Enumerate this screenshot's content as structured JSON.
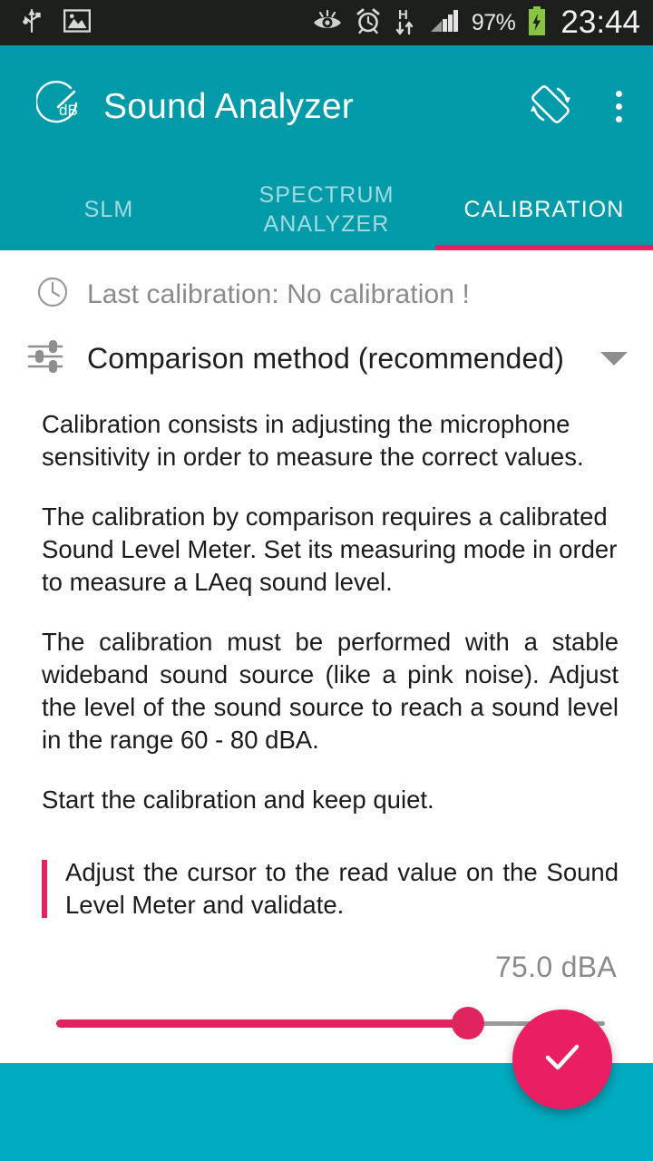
{
  "statusbar": {
    "icons_left": [
      "usb-icon",
      "image-icon"
    ],
    "icons_right": [
      "eye-icon",
      "alarm-icon",
      "hspa-data-icon",
      "signal-icon"
    ],
    "battery_percent": "97%",
    "battery_icon": "battery-charging-icon",
    "clock": "23:44"
  },
  "appbar": {
    "logo_icon": "sound-analyzer-db-gauge-icon",
    "logo_text": "dB",
    "title": "Sound Analyzer",
    "rotate_icon": "screen-rotation-icon",
    "overflow_icon": "overflow-menu-icon"
  },
  "tabs": [
    {
      "label": "SLM",
      "active": false
    },
    {
      "label": "SPECTRUM ANALYZER",
      "active": false
    },
    {
      "label": "CALIBRATION",
      "active": true
    }
  ],
  "content": {
    "last_calibration": {
      "icon": "clock-icon",
      "text": "Last calibration: No calibration !"
    },
    "method_selector": {
      "icon": "tune-sliders-icon",
      "value": "Comparison method (recommended)",
      "caret_icon": "chevron-down-icon"
    },
    "paragraphs": [
      "Calibration consists in adjusting the microphone sensitivity in order to measure the correct values.",
      "The calibration by comparison requires a calibrated Sound Level Meter. Set its measuring mode in order to measure a LAeq sound level.",
      "The calibration must be performed with a stable wideband sound source (like a pink noise). Adjust the level of the sound source to reach a sound level in the range 60 - 80 dBA.",
      "Start the calibration and keep quiet."
    ],
    "highlight_instruction": "Adjust the cursor to the read value on the Sound Level Meter and validate.",
    "slider": {
      "value_label": "75.0 dBA",
      "value": 75.0,
      "fill_percent": 75
    },
    "fab": {
      "icon": "check-icon",
      "label": "Validate calibration"
    }
  },
  "colors": {
    "teal_primary": "#009aa8",
    "teal_bottom": "#00acc1",
    "accent_pink": "#e0245e",
    "fab_pink": "#e91e63",
    "statusbar": "#1c1f1c",
    "body_text": "#1b1b1b",
    "muted_text": "#8a8a8a"
  }
}
